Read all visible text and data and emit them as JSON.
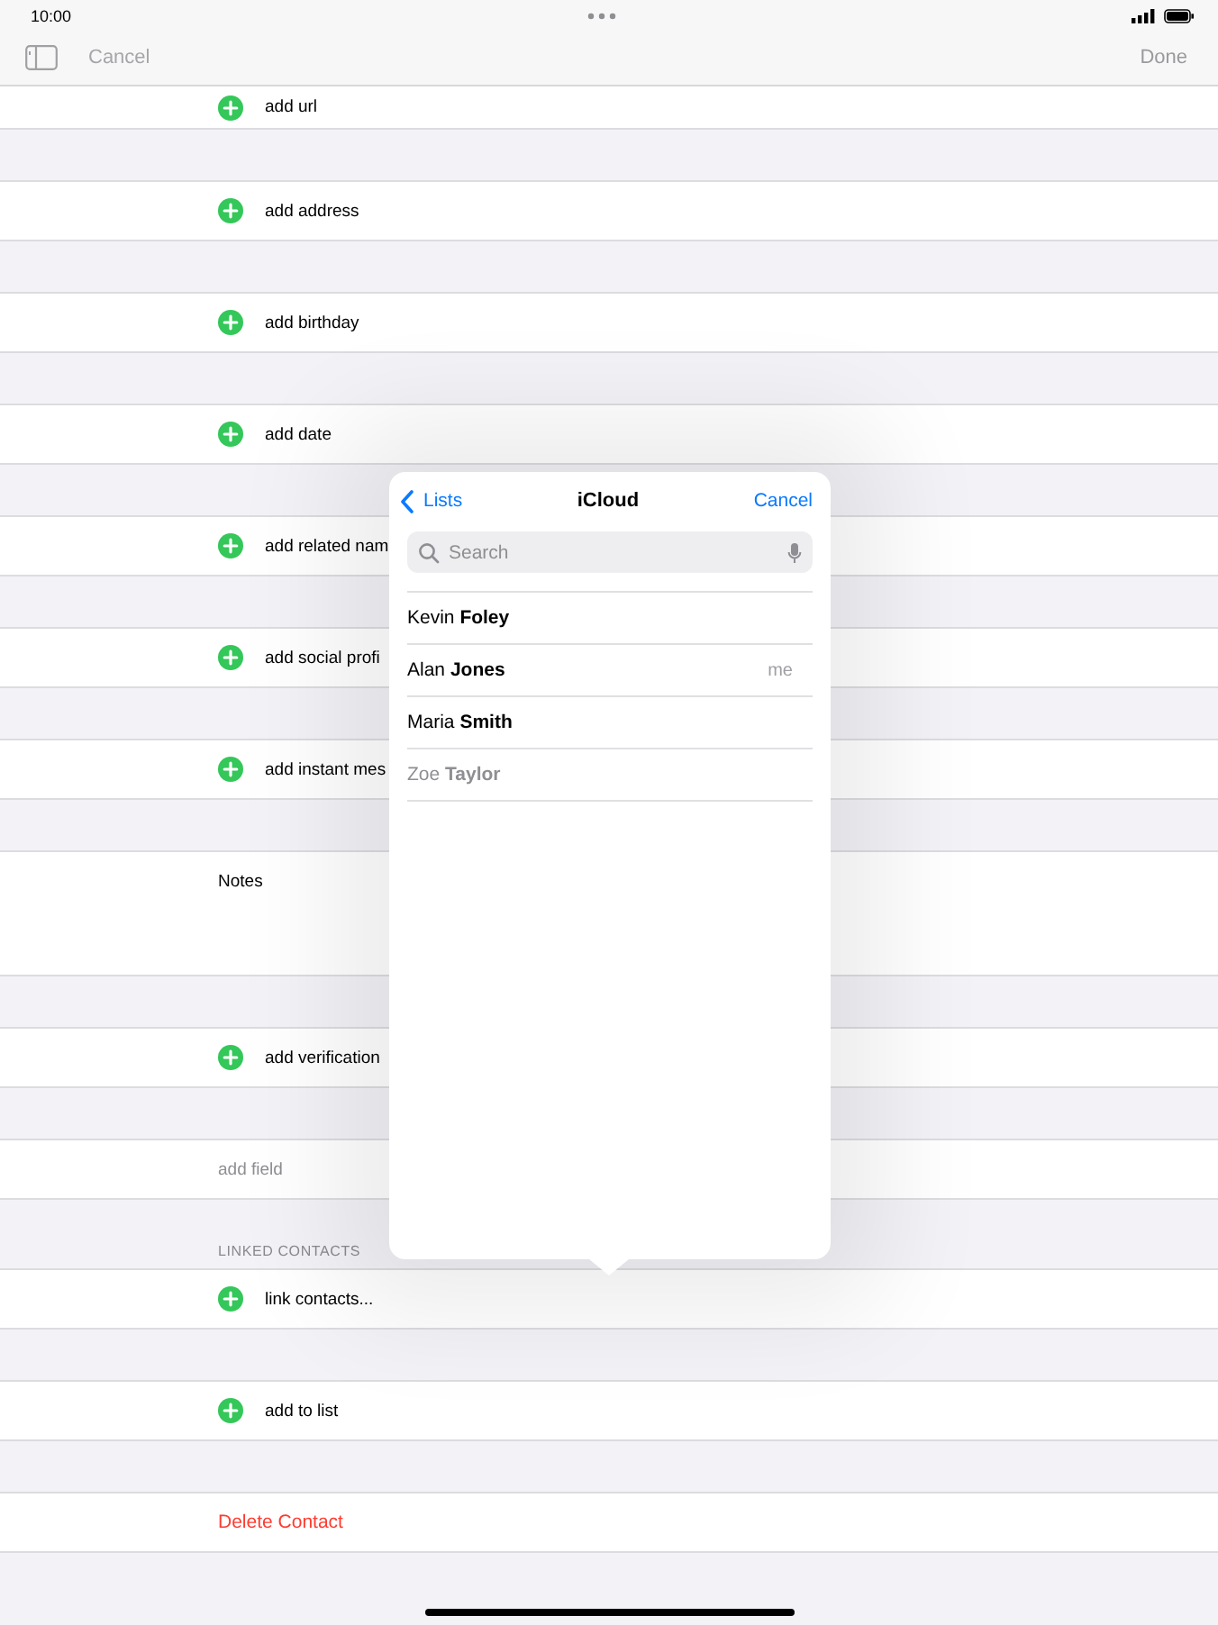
{
  "status_bar": {
    "time": "10:00"
  },
  "nav": {
    "cancel": {
      "label": "Cancel",
      "disabled": true
    },
    "done": {
      "label": "Done",
      "disabled": true
    }
  },
  "sections": [
    {
      "rows": [
        {
          "kind": "add",
          "label": "add url"
        }
      ]
    },
    {
      "rows": [
        {
          "kind": "add",
          "label": "add address"
        }
      ]
    },
    {
      "rows": [
        {
          "kind": "add",
          "label": "add birthday"
        }
      ]
    },
    {
      "rows": [
        {
          "kind": "add",
          "label": "add date"
        }
      ]
    },
    {
      "rows": [
        {
          "kind": "add",
          "label": "add related nam"
        }
      ]
    },
    {
      "rows": [
        {
          "kind": "add",
          "label": "add social profi"
        }
      ]
    },
    {
      "rows": [
        {
          "kind": "add",
          "label": "add instant mes"
        }
      ]
    },
    {
      "rows": [
        {
          "kind": "notes",
          "label": "Notes"
        }
      ]
    },
    {
      "rows": [
        {
          "kind": "add",
          "label": "add verification"
        }
      ]
    },
    {
      "rows": [
        {
          "kind": "placeholder",
          "label": "add field"
        }
      ]
    },
    {
      "header": "LINKED CONTACTS",
      "rows": [
        {
          "kind": "add",
          "label": "link contacts..."
        }
      ]
    },
    {
      "rows": [
        {
          "kind": "add",
          "label": "add to list"
        }
      ]
    },
    {
      "rows": [
        {
          "kind": "destructive",
          "label": "Delete Contact"
        }
      ]
    }
  ],
  "popover": {
    "back": "Lists",
    "title": "iCloud",
    "cancel": "Cancel",
    "search": {
      "placeholder": "Search"
    },
    "contacts": [
      {
        "name": "Kevin **Foley**",
        "disabled": false
      },
      {
        "name": "Alan **Jones**",
        "note": "me",
        "disabled": false
      },
      {
        "name": "Maria **Smith**",
        "disabled": false
      },
      {
        "name": "Zoe **Taylor**",
        "disabled": true
      }
    ]
  }
}
